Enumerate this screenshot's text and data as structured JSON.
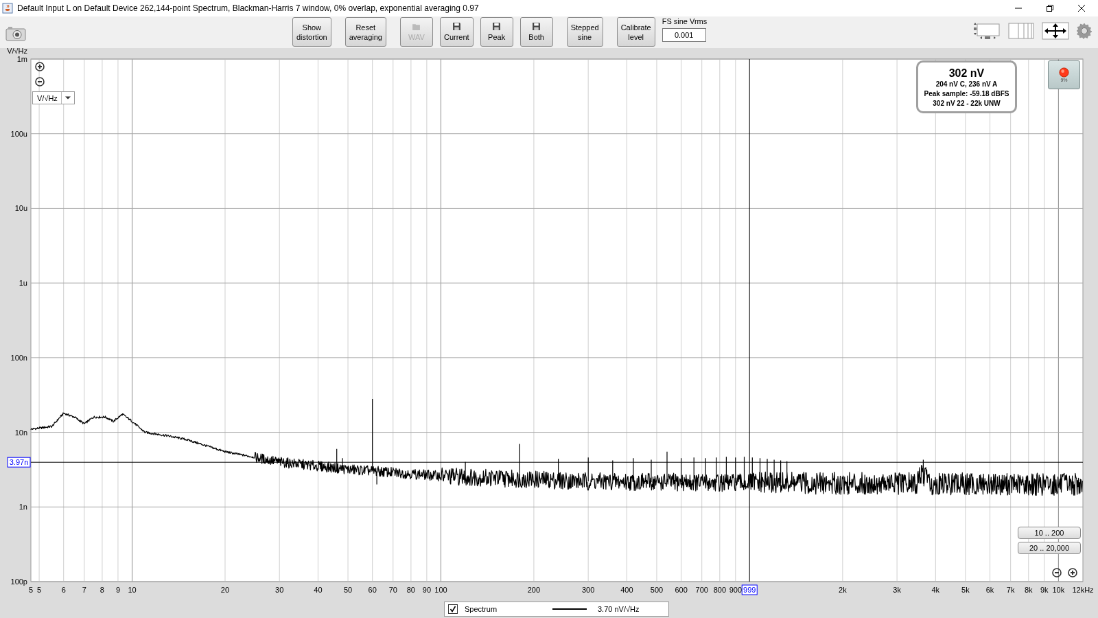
{
  "window": {
    "title": "Default Input L on Default Device 262,144-point Spectrum, Blackman-Harris 7 window, 0% overlap, exponential averaging 0.97"
  },
  "toolbar": {
    "buttons": [
      {
        "kind": "text",
        "lines": [
          "Show",
          "distortion"
        ],
        "disabled": false
      },
      {
        "kind": "text",
        "lines": [
          "Reset",
          "averaging"
        ],
        "disabled": false
      },
      {
        "kind": "load",
        "lines": [
          "WAV"
        ],
        "disabled": true
      },
      {
        "kind": "save",
        "lines": [
          "Current"
        ],
        "disabled": false
      },
      {
        "kind": "save",
        "lines": [
          "Peak"
        ],
        "disabled": false
      },
      {
        "kind": "save",
        "lines": [
          "Both"
        ],
        "disabled": false
      },
      {
        "kind": "text",
        "lines": [
          "Stepped",
          "sine"
        ],
        "disabled": false
      },
      {
        "kind": "text",
        "lines": [
          "Calibrate",
          "level"
        ],
        "disabled": false
      }
    ],
    "fs_field": {
      "label": "FS sine Vrms",
      "value": "0.001"
    }
  },
  "graph": {
    "unit_dropdown": {
      "value": "V/√Hz"
    },
    "readout": {
      "value": "302 nV",
      "details": [
        "204 nV C, 236 nV A",
        "Peak sample: -59.18 dBFS",
        "302 nV 22 - 22k UNW"
      ]
    },
    "level_indicator": {
      "text": "9%"
    },
    "range_buttons": [
      "10 .. 200",
      "20 .. 20,000"
    ],
    "y_unit": "V/√Hz",
    "y_labels": [
      "1m",
      "100u",
      "10u",
      "1u",
      "100n",
      "10n",
      "1n",
      "100p"
    ],
    "x_labels": [
      "5",
      "5",
      "6",
      "7",
      "8",
      "9",
      "10",
      "20",
      "30",
      "40",
      "50",
      "60",
      "70",
      "80",
      "90",
      "100",
      "200",
      "300",
      "400",
      "500",
      "600",
      "700",
      "800",
      "900",
      "2k",
      "3k",
      "4k",
      "5k",
      "6k",
      "7k",
      "8k",
      "9k",
      "10k",
      "12kHz"
    ],
    "cursor": {
      "y_label": "3.97n",
      "x_label": "999"
    }
  },
  "legend": {
    "checked": true,
    "name": "Spectrum",
    "reading": "3.70 nV/√Hz"
  }
}
